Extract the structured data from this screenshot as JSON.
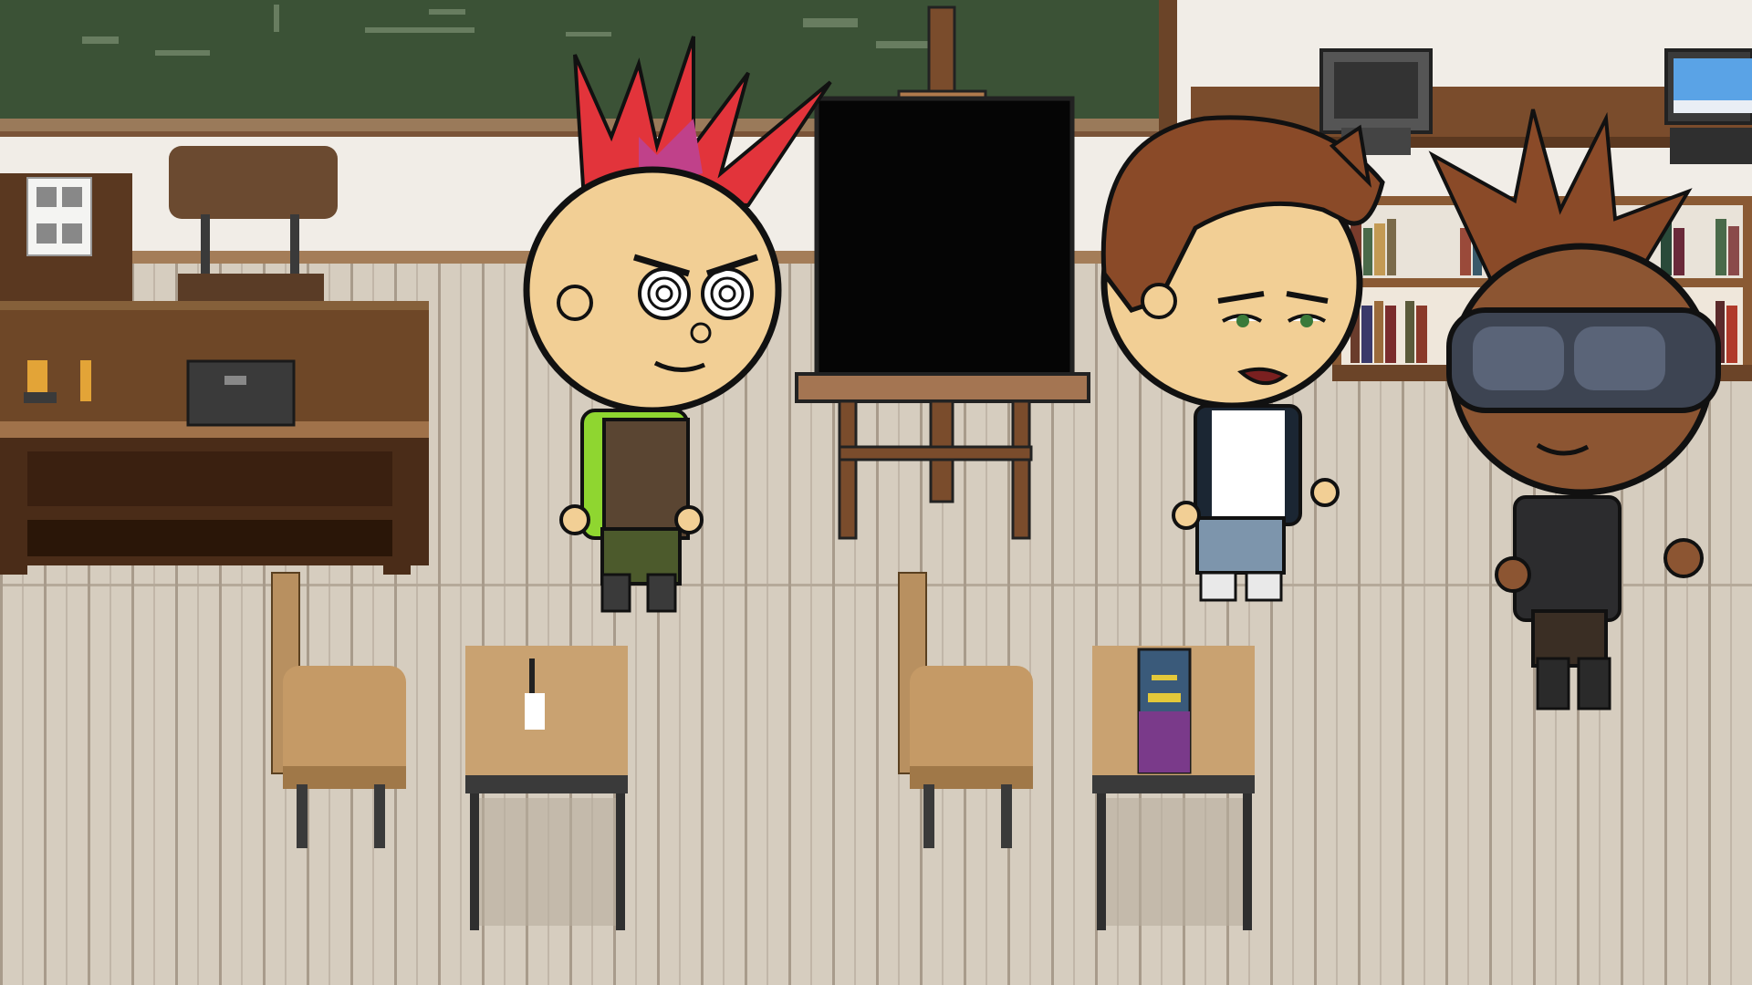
{
  "scene": {
    "type": "classroom",
    "palette": {
      "floor": "#d6cdbf",
      "floor_seam": "#9b8f80",
      "chalkboard": "#3b5236",
      "chalkboard_frame": "#7a5438",
      "wall": "#f1ede7",
      "wood_dark": "#6b4428",
      "wood_light": "#b58c5e",
      "easel_board": "#050505"
    }
  },
  "characters": [
    {
      "id": "punk-red-mohawk",
      "hair_color": "#e2343b",
      "skin": "#f2cf95",
      "eyes": "spiral",
      "shirt": "#8fd630",
      "vest": "#5a4532",
      "pants": "#4c5a2c"
    },
    {
      "id": "brown-hair-kid",
      "hair_color": "#8a4a28",
      "skin": "#f2cf95",
      "eyes": "half-closed",
      "shirt": "#ffffff",
      "jacket": "#1b2633",
      "pants": "#7d95ac"
    },
    {
      "id": "goggles-mohawk",
      "hair_color": "#8a4a28",
      "skin": "#8c5532",
      "goggles": "#3d4452",
      "vest": "#2c2c2e",
      "pants": "#3a2e24"
    }
  ],
  "props": [
    "chalkboard",
    "easel",
    "teacher-desk",
    "laptop",
    "chair",
    "student-desk",
    "book",
    "bookshelf",
    "crt-monitor",
    "computer"
  ]
}
